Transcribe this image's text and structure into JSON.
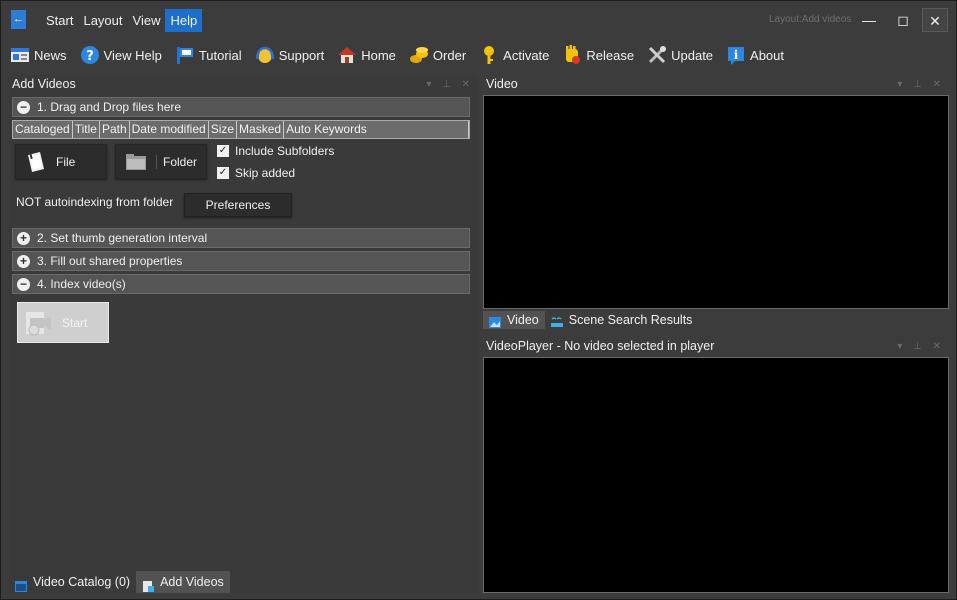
{
  "app": {
    "layout_label": "Layout:Add videos"
  },
  "menu": {
    "items": [
      "Start",
      "Layout",
      "View",
      "Help"
    ],
    "active": "Help"
  },
  "toolbar": {
    "items": [
      {
        "label": "News",
        "icon": "news-icon"
      },
      {
        "label": "View Help",
        "icon": "help-icon"
      },
      {
        "label": "Tutorial",
        "icon": "tutorial-icon"
      },
      {
        "label": "Support",
        "icon": "support-icon"
      },
      {
        "label": "Home",
        "icon": "home-icon"
      },
      {
        "label": "Order",
        "icon": "order-icon"
      },
      {
        "label": "Activate",
        "icon": "key-icon"
      },
      {
        "label": "Release",
        "icon": "release-icon"
      },
      {
        "label": "Update",
        "icon": "update-icon"
      },
      {
        "label": "About",
        "icon": "about-icon"
      }
    ]
  },
  "add_videos": {
    "title": "Add Videos",
    "section1": {
      "label": "1. Drag and Drop files here",
      "expanded": true
    },
    "columns": [
      "Cataloged",
      "Title",
      "Path",
      "Date modified",
      "Size",
      "Masked",
      "Auto Keywords"
    ],
    "file_button": "File",
    "folder_button": "Folder",
    "include_subfolders": {
      "label": "Include Subfolders",
      "checked": true
    },
    "skip_added": {
      "label": "Skip added",
      "checked": true
    },
    "autoindex_text": "NOT autoindexing from folder",
    "preferences_button": "Preferences",
    "section2": {
      "label": "2. Set thumb generation interval",
      "expanded": false
    },
    "section3": {
      "label": "3. Fill out shared properties",
      "expanded": false
    },
    "section4": {
      "label": "4. Index video(s)",
      "expanded": true
    },
    "start_button": "Start"
  },
  "bottom_tabs": {
    "catalog": "Video Catalog (0)",
    "add": "Add Videos"
  },
  "video_panel": {
    "title": "Video",
    "tabs": {
      "video": "Video",
      "scene": "Scene Search Results"
    }
  },
  "player_panel": {
    "title": "VideoPlayer - No video selected in player"
  },
  "colors": {
    "accent": "#1e6fc9",
    "background": "#3c3c3c",
    "video_bg": "#000000"
  }
}
